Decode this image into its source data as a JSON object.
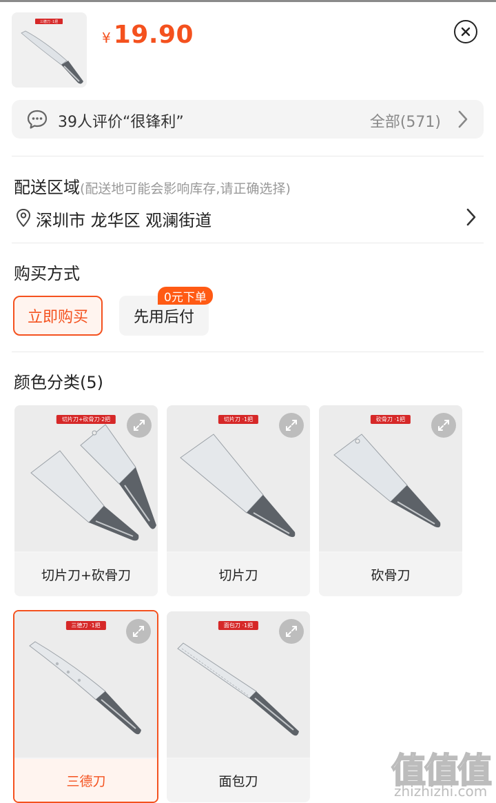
{
  "header": {
    "currency": "¥",
    "price": "19.90",
    "thumbnail_tag": "三德刀 ·1把"
  },
  "reviews": {
    "summary": "39人评价“很锋利”",
    "all_label": "全部(571)"
  },
  "delivery": {
    "title": "配送区域",
    "hint": "(配送地可能会影响库存,请正确选择)",
    "address": "深圳市 龙华区 观澜街道"
  },
  "purchase": {
    "title": "购买方式",
    "options": [
      {
        "label": "立即购买",
        "selected": true
      },
      {
        "label": "先用后付",
        "badge": "0元下单",
        "selected": false
      }
    ]
  },
  "colors": {
    "title": "颜色分类(5)",
    "items": [
      {
        "label": "切片刀+砍骨刀",
        "tag": "切片刀+砍骨刀·2把",
        "selected": false
      },
      {
        "label": "切片刀",
        "tag": "切片刀 ·1把",
        "selected": false
      },
      {
        "label": "砍骨刀",
        "tag": "砍骨刀 ·1把",
        "selected": false
      },
      {
        "label": "三德刀",
        "tag": "三德刀 ·1把",
        "selected": true
      },
      {
        "label": "面包刀",
        "tag": "面包刀 ·1把",
        "selected": false
      }
    ]
  },
  "watermark": {
    "glyphs": "值值值",
    "url": "zhizhizhi.com"
  },
  "theme": {
    "accent": "#f4511e",
    "badge": "#ff5a14",
    "tag_red": "#d62828"
  }
}
